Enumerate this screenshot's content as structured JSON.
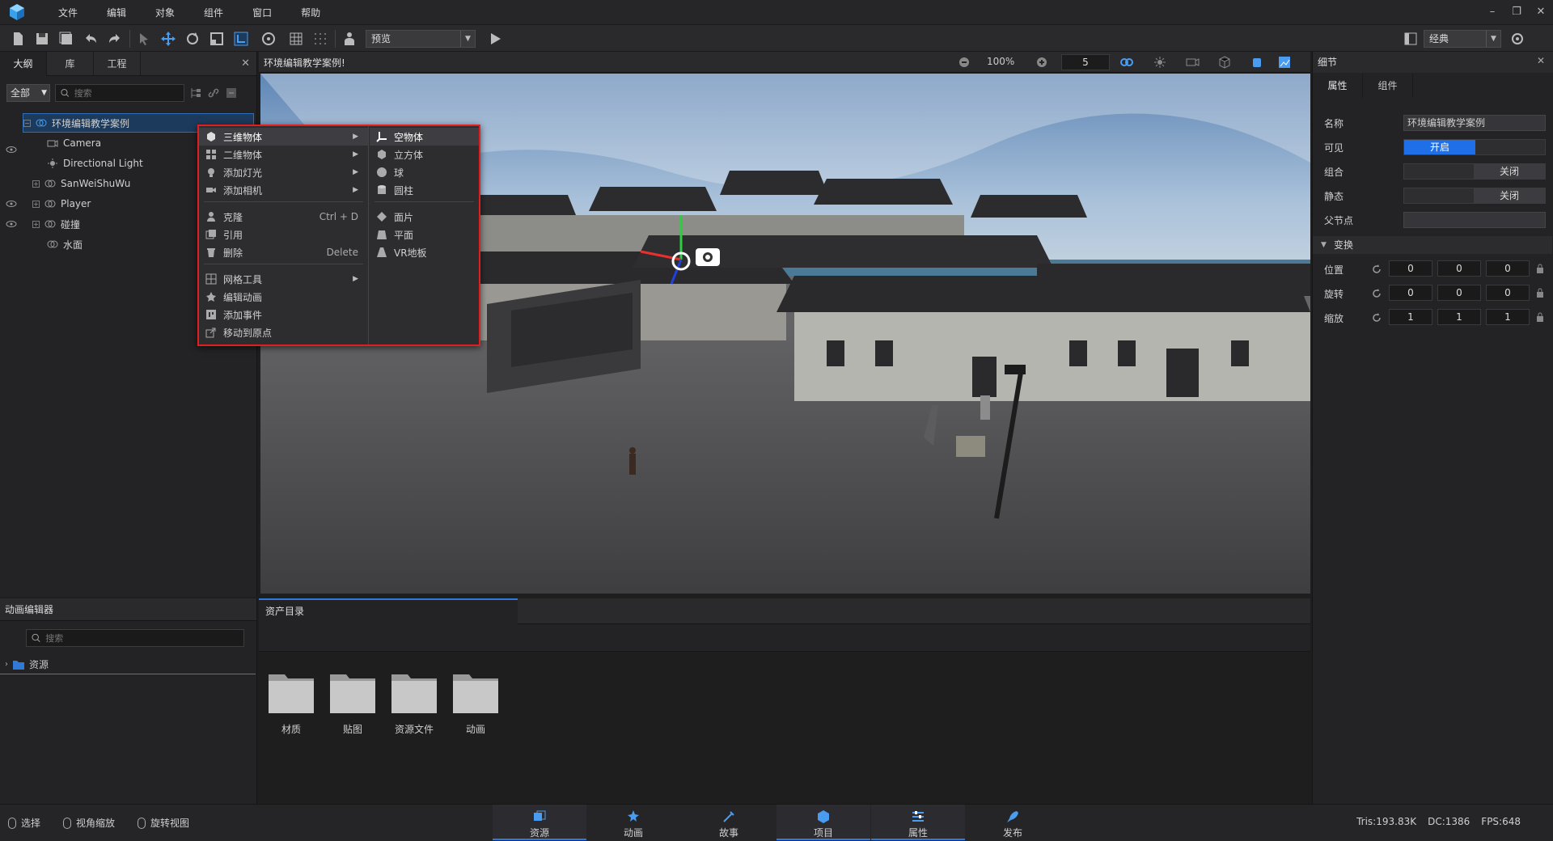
{
  "menubar": {
    "items": [
      "文件",
      "编辑",
      "对象",
      "组件",
      "窗口",
      "帮助"
    ]
  },
  "toolbar": {
    "preview_mode": "预览",
    "layout_mode": "经典"
  },
  "outline": {
    "tabs": [
      "大纲",
      "库",
      "工程"
    ],
    "filter": "全部",
    "search_placeholder": "搜索",
    "tree": [
      {
        "label": "环境编辑教学案例",
        "selected": true
      },
      {
        "label": "Camera"
      },
      {
        "label": "Directional Light"
      },
      {
        "label": "SanWeiShuWu"
      },
      {
        "label": "Player"
      },
      {
        "label": "碰撞"
      },
      {
        "label": "水面"
      }
    ]
  },
  "viewport": {
    "title": "环境编辑教学案例!",
    "zoom": "100%",
    "grid_value": "5"
  },
  "context_menu": {
    "main": [
      {
        "label": "三维物体",
        "submenu": true,
        "highlighted": true
      },
      {
        "label": "二维物体",
        "submenu": true
      },
      {
        "label": "添加灯光",
        "submenu": true
      },
      {
        "label": "添加相机",
        "submenu": true
      },
      {
        "label": "克隆",
        "shortcut": "Ctrl + D"
      },
      {
        "label": "引用"
      },
      {
        "label": "删除",
        "shortcut": "Delete"
      },
      {
        "label": "网格工具",
        "submenu": true
      },
      {
        "label": "编辑动画"
      },
      {
        "label": "添加事件"
      },
      {
        "label": "移动到原点"
      }
    ],
    "sub": [
      {
        "label": "空物体",
        "highlighted": true
      },
      {
        "label": "立方体"
      },
      {
        "label": "球"
      },
      {
        "label": "圆柱"
      },
      {
        "label": "面片"
      },
      {
        "label": "平面"
      },
      {
        "label": "VR地板"
      }
    ]
  },
  "details": {
    "title": "细节",
    "tabs": [
      "属性",
      "组件"
    ],
    "name_label": "名称",
    "name_value": "环境编辑教学案例",
    "visible_label": "可见",
    "visible_on": "开启",
    "group_label": "组合",
    "group_off": "关闭",
    "static_label": "静态",
    "static_off": "关闭",
    "parent_label": "父节点",
    "transform_label": "变换",
    "position": {
      "label": "位置",
      "values": [
        "0",
        "0",
        "0"
      ]
    },
    "rotation": {
      "label": "旋转",
      "values": [
        "0",
        "0",
        "0"
      ]
    },
    "scale": {
      "label": "缩放",
      "values": [
        "1",
        "1",
        "1"
      ]
    }
  },
  "anim_editor": {
    "title": "动画编辑器",
    "search_placeholder": "搜索",
    "root": "资源"
  },
  "assets": {
    "tab": "资产目录",
    "folders": [
      "材质",
      "贴图",
      "资源文件",
      "动画"
    ]
  },
  "status": {
    "mouse_hints": [
      "选择",
      "视角缩放",
      "旋转视图"
    ],
    "nav": [
      "资源",
      "动画",
      "故事",
      "项目",
      "属性",
      "发布"
    ],
    "active_nav": [
      "资源",
      "项目",
      "属性"
    ],
    "tris": "Tris:193.83K",
    "dc": "DC:1386",
    "fps": "FPS:648"
  },
  "colors": {
    "accent": "#2f7ad8",
    "highlight_red": "#e02020",
    "toggle_on": "#1e6fe8"
  }
}
